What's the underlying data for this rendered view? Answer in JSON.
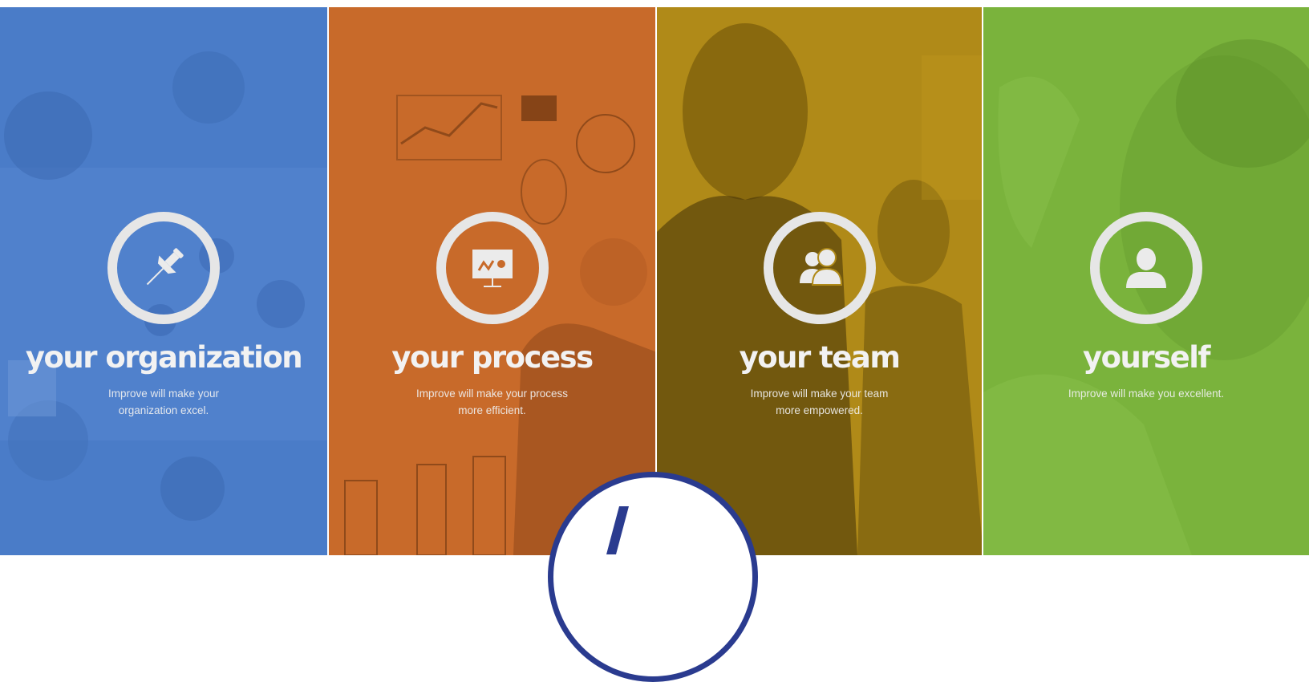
{
  "panels": [
    {
      "title": "your organization",
      "desc_line1": "Improve will make your",
      "desc_line2": "organization excel.",
      "icon": "pushpin-icon",
      "color": "#4a7cc8"
    },
    {
      "title": "your process",
      "desc_line1": "Improve will make your process",
      "desc_line2": "more efficient.",
      "icon": "presentation-board-icon",
      "color": "#c86a2a"
    },
    {
      "title": "your team",
      "desc_line1": "Improve will make your team",
      "desc_line2": "more empowered.",
      "icon": "team-icon",
      "color": "#b08a18"
    },
    {
      "title": "yourself",
      "desc_line1": "Improve will make you excellent.",
      "desc_line2": "",
      "icon": "user-icon",
      "color": "#7ab33c"
    }
  ],
  "logo": {
    "icon": "improve-logo-icon",
    "border_color": "#2a3b8f",
    "mark_color": "#2a3b8f"
  }
}
